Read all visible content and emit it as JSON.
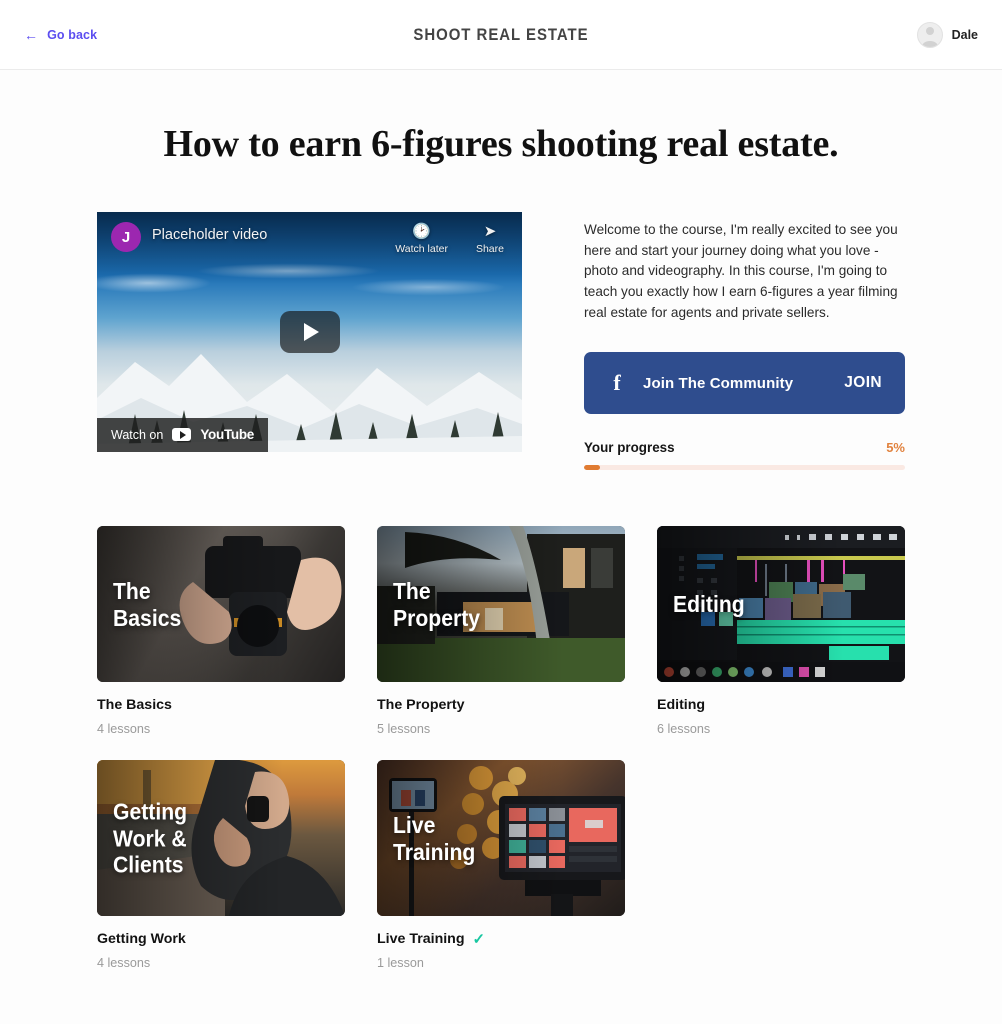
{
  "header": {
    "go_back_label": "Go back",
    "back_arrow_icon": "arrow-left-icon",
    "brand_title": "SHOOT REAL ESTATE",
    "user_name": "Dale",
    "avatar_icon": "user-avatar-icon"
  },
  "page_title": "How to earn 6-figures shooting real estate.",
  "video": {
    "channel_initial": "J",
    "title": "Placeholder video",
    "watch_later_label": "Watch later",
    "watch_later_icon": "clock-icon",
    "share_label": "Share",
    "share_icon": "share-arrow-icon",
    "play_icon": "play-button-icon",
    "watch_on_label": "Watch on",
    "youtube_label": "YouTube",
    "youtube_icon": "youtube-play-icon"
  },
  "description": "Welcome to the course, I'm really excited to see you here and start your journey doing what you love - photo and videography. In this course, I'm going to teach you exactly how I earn 6-figures a year filming real estate for agents and private sellers.",
  "community": {
    "facebook_icon": "facebook-f-icon",
    "label": "Join The Community",
    "join_label": "JOIN",
    "color": "#2f4d8e"
  },
  "progress": {
    "label": "Your progress",
    "percent_text": "5%",
    "percent_value": 5,
    "fill_color": "#e07b32",
    "track_color": "#fae9e3"
  },
  "courses": [
    {
      "overlay": "The\nBasics",
      "title": "The Basics",
      "lessons": "4 lessons",
      "completed": false
    },
    {
      "overlay": "The\nProperty",
      "title": "The Property",
      "lessons": "5 lessons",
      "completed": false
    },
    {
      "overlay": "Editing",
      "title": "Editing",
      "lessons": "6 lessons",
      "completed": false
    },
    {
      "overlay": "Getting\nWork &\nClients",
      "title": "Getting Work",
      "lessons": "4 lessons",
      "completed": false
    },
    {
      "overlay": "Live\nTraining",
      "title": "Live Training",
      "lessons": "1 lesson",
      "completed": true
    }
  ],
  "check_icon": "check-mark-icon",
  "check_color": "#18c7a1",
  "accent_color": "#5b4df0"
}
